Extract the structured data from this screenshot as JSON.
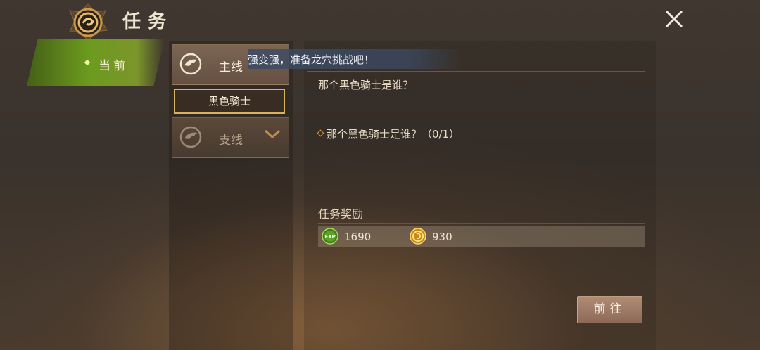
{
  "header": {
    "title": "任务",
    "emblem_icon": "dragon-emblem-icon",
    "close_icon": "close-icon"
  },
  "tabs": [
    {
      "label": "当前",
      "selected": true
    }
  ],
  "quest_categories": {
    "main": {
      "label": "主线",
      "icon": "horse-crest-icon",
      "expanded": true
    },
    "main_items": [
      {
        "label": "黑色骑士",
        "selected": true
      }
    ],
    "side": {
      "label": "支线",
      "icon": "horse-crest-icon",
      "expanded": false,
      "toggle_icon": "chevron-down-icon"
    }
  },
  "banner": {
    "text": "强变强，准备龙穴挑战吧！"
  },
  "detail": {
    "description": "那个黑色骑士是谁？",
    "objective": "那个黑色骑士是谁？（0/1）",
    "rewards_title": "任务奖励",
    "rewards": [
      {
        "icon": "exp-orb-icon",
        "icon_text": "EXP",
        "value": "1690"
      },
      {
        "icon": "gold-coin-icon",
        "value": "930"
      }
    ],
    "go_button": "前往"
  },
  "colors": {
    "accent_green": "#8cc02a",
    "selected_border": "#d9b25a",
    "button": "#9d7a66"
  }
}
